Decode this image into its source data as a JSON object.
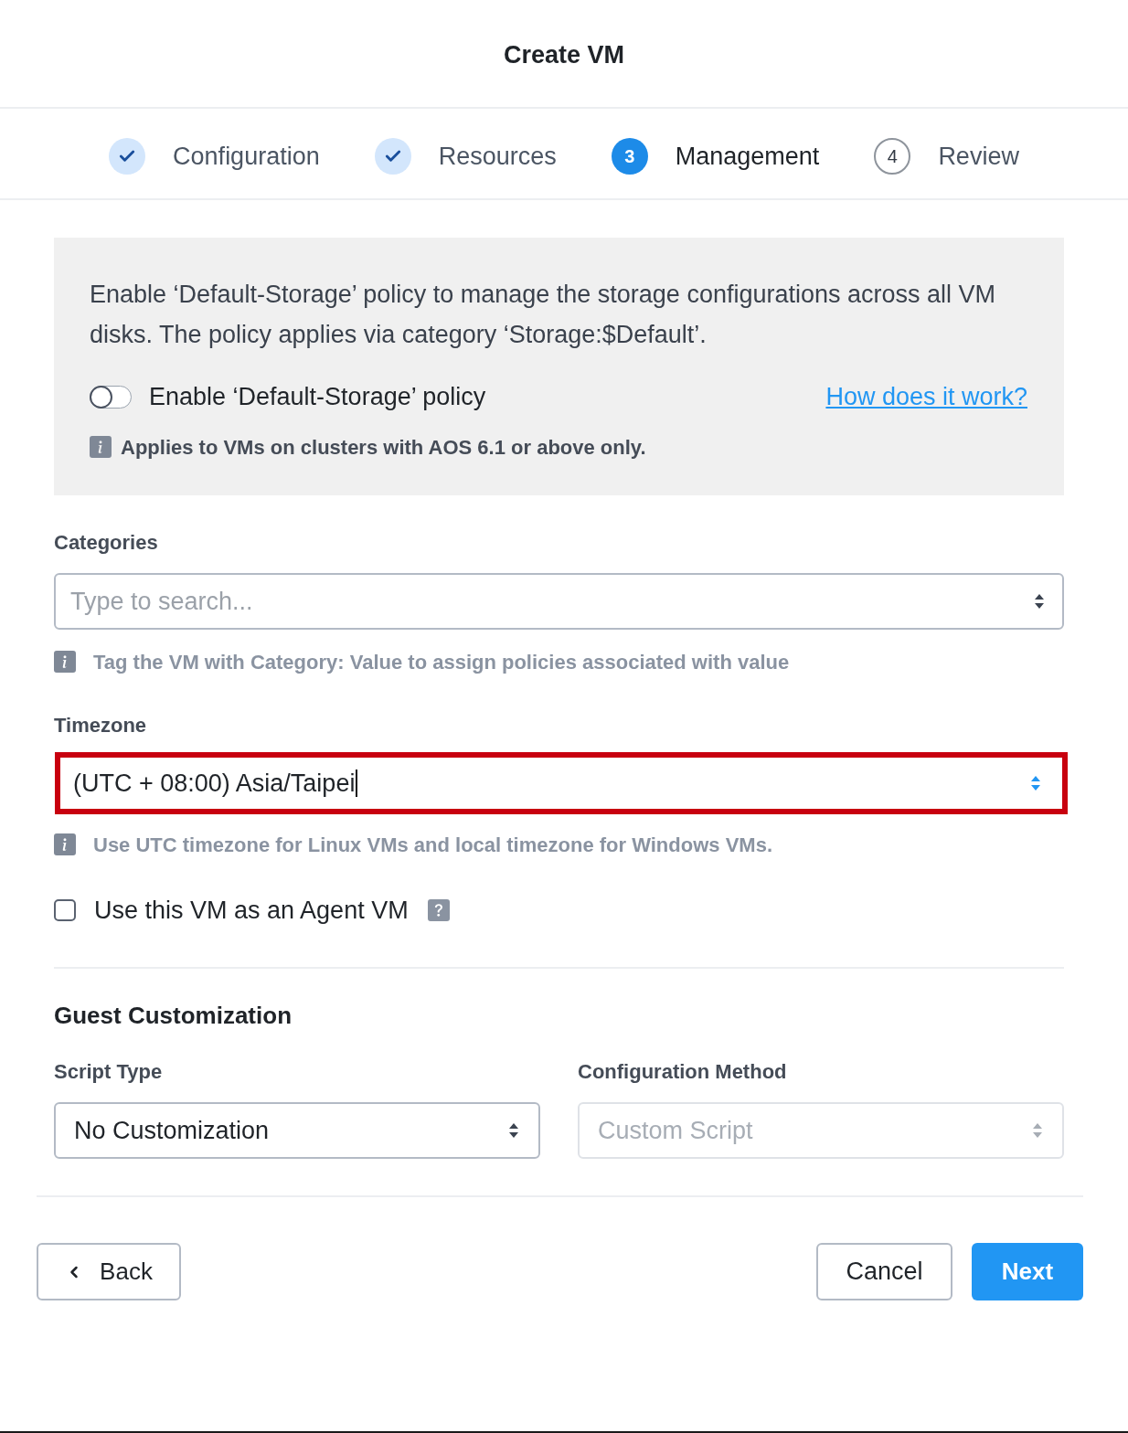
{
  "dialog": {
    "title": "Create VM"
  },
  "steps": [
    {
      "label": "Configuration",
      "completed": true,
      "selected": false
    },
    {
      "label": "Resources",
      "completed": true,
      "selected": false
    },
    {
      "label": "Management",
      "number": "3",
      "completed": false,
      "selected": true
    },
    {
      "label": "Review",
      "number": "4",
      "completed": false,
      "selected": false
    }
  ],
  "policy_panel": {
    "description": "Enable ‘Default-Storage’ policy to manage the storage configurations across all VM disks. The policy applies via category ‘Storage:$Default’.",
    "toggle": {
      "label": "Enable ‘Default-Storage’ policy",
      "on": false
    },
    "link": "How does it work?",
    "note": "Applies to VMs on clusters with AOS 6.1 or above only."
  },
  "categories": {
    "label": "Categories",
    "placeholder": "Type to search...",
    "hint": "Tag the VM with Category: Value to assign policies associated with value"
  },
  "timezone": {
    "label": "Timezone",
    "value": "(UTC + 08:00) Asia/Taipei",
    "focused": true,
    "highlighted": true,
    "hint": "Use UTC timezone for Linux VMs and local timezone for Windows VMs."
  },
  "agent_vm": {
    "label": "Use this VM as an Agent VM",
    "checked": false
  },
  "guest_customization": {
    "title": "Guest Customization",
    "fields": [
      {
        "label": "Script Type",
        "value": "No Customization",
        "disabled": false
      },
      {
        "label": "Configuration Method",
        "value": "Custom Script",
        "disabled": true
      }
    ]
  },
  "footer": {
    "back": "Back",
    "cancel": "Cancel",
    "next": "Next"
  }
}
